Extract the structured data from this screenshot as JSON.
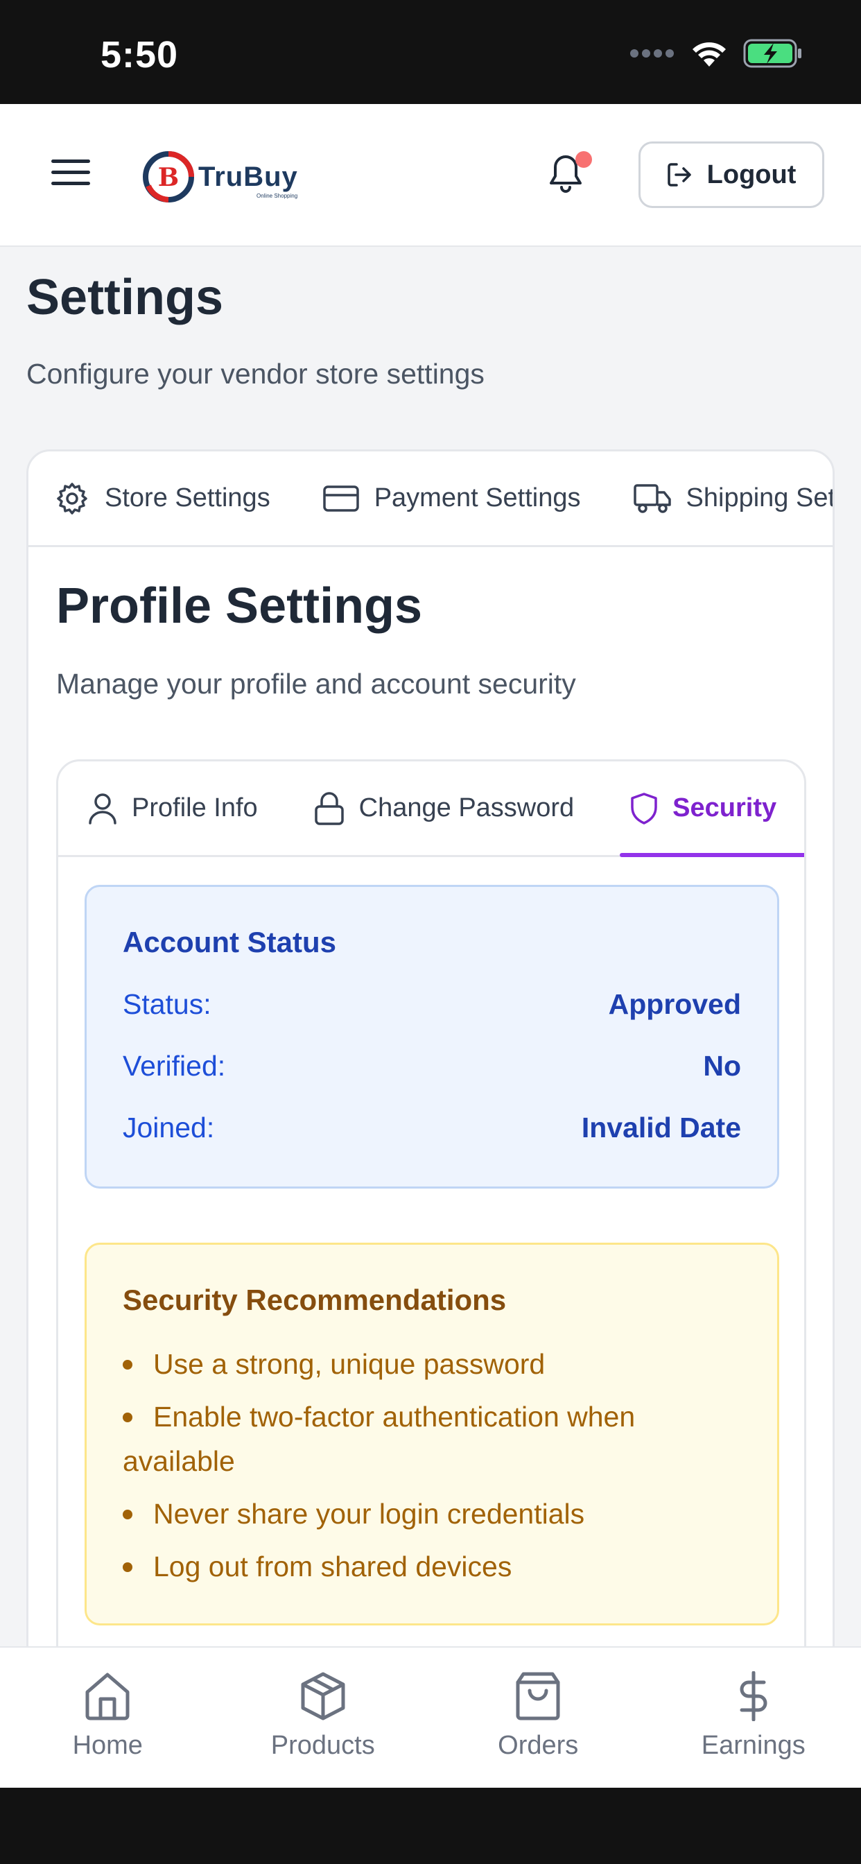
{
  "status_bar": {
    "time": "5:50"
  },
  "header": {
    "logo_text": "TruBuy",
    "logo_tagline": "Online Shopping",
    "logout_label": "Logout"
  },
  "page": {
    "title": "Settings",
    "subtitle": "Configure your vendor store settings"
  },
  "main_tabs": [
    {
      "label": "Store Settings",
      "icon": "gear-icon"
    },
    {
      "label": "Payment Settings",
      "icon": "credit-card-icon"
    },
    {
      "label": "Shipping Settings",
      "icon": "truck-icon"
    }
  ],
  "profile": {
    "title": "Profile Settings",
    "subtitle": "Manage your profile and account security"
  },
  "sub_tabs": [
    {
      "label": "Profile Info",
      "icon": "user-icon"
    },
    {
      "label": "Change Password",
      "icon": "lock-icon"
    },
    {
      "label": "Security",
      "icon": "shield-icon",
      "active": true
    }
  ],
  "account_status": {
    "title": "Account Status",
    "rows": [
      {
        "label": "Status:",
        "value": "Approved"
      },
      {
        "label": "Verified:",
        "value": "No"
      },
      {
        "label": "Joined:",
        "value": "Invalid Date"
      }
    ]
  },
  "recommendations": {
    "title": "Security Recommendations",
    "items": [
      "Use a strong, unique password",
      "Enable two-factor authentication when available",
      "Never share your login credentials",
      "Log out from shared devices"
    ]
  },
  "bottom_nav": [
    {
      "label": "Home",
      "icon": "home-icon"
    },
    {
      "label": "Products",
      "icon": "package-icon"
    },
    {
      "label": "Orders",
      "icon": "shopping-bag-icon"
    },
    {
      "label": "Earnings",
      "icon": "dollar-icon"
    }
  ],
  "colors": {
    "accent": "#9333ea",
    "status_blue": "#1e40af",
    "warning_text": "#a16207",
    "notification_dot": "#f87171"
  }
}
